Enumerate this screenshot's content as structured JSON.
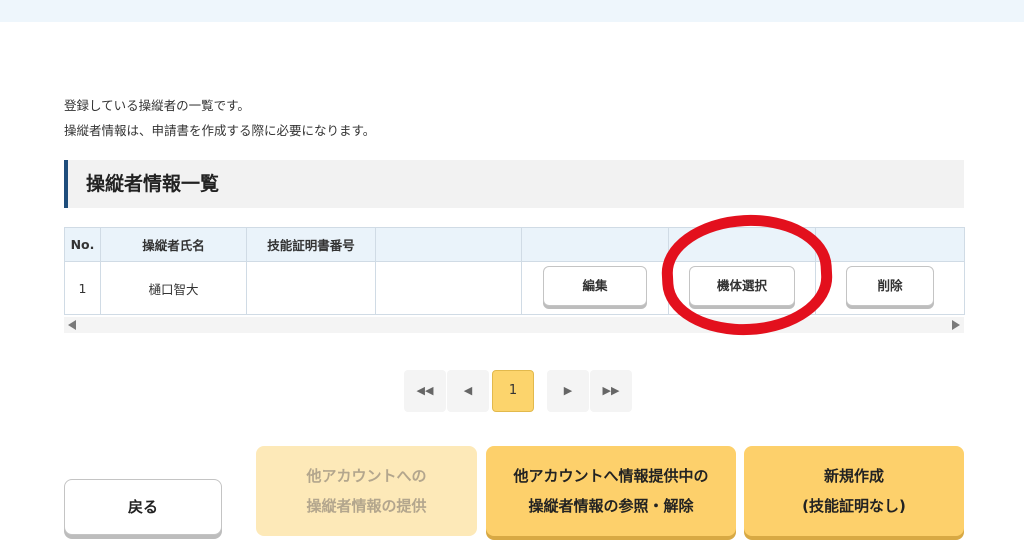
{
  "intro": {
    "line1": "登録している操縦者の一覧です。",
    "line2": "操縦者情報は、申請書を作成する際に必要になります。"
  },
  "section_title": "操縦者情報一覧",
  "table": {
    "headers": [
      "No.",
      "操縦者氏名",
      "技能証明書番号",
      "",
      "",
      "",
      ""
    ],
    "rows": [
      {
        "no": "1",
        "name": "樋口智大",
        "cert_no": "",
        "blank": "",
        "edit": "編集",
        "select_aircraft": "機体選択",
        "delete": "削除"
      }
    ]
  },
  "pagination": {
    "first": "◀◀",
    "prev": "◀",
    "current": "1",
    "next": "▶",
    "last": "▶▶"
  },
  "buttons": {
    "back": "戻る",
    "share_line1": "他アカウントへの",
    "share_line2": "操縦者情報の提供",
    "shared_line1": "他アカウントへ情報提供中の",
    "shared_line2": "操縦者情報の参照・解除",
    "create_line1": "新規作成",
    "create_line2": "(技能証明なし)"
  },
  "colors": {
    "accent_yellow": "#fdd06b",
    "disabled_yellow": "#fde9b8",
    "header_blue": "#eaf3fa",
    "title_bar_accent": "#1e4d7b",
    "annotation_red": "#e3101d"
  }
}
